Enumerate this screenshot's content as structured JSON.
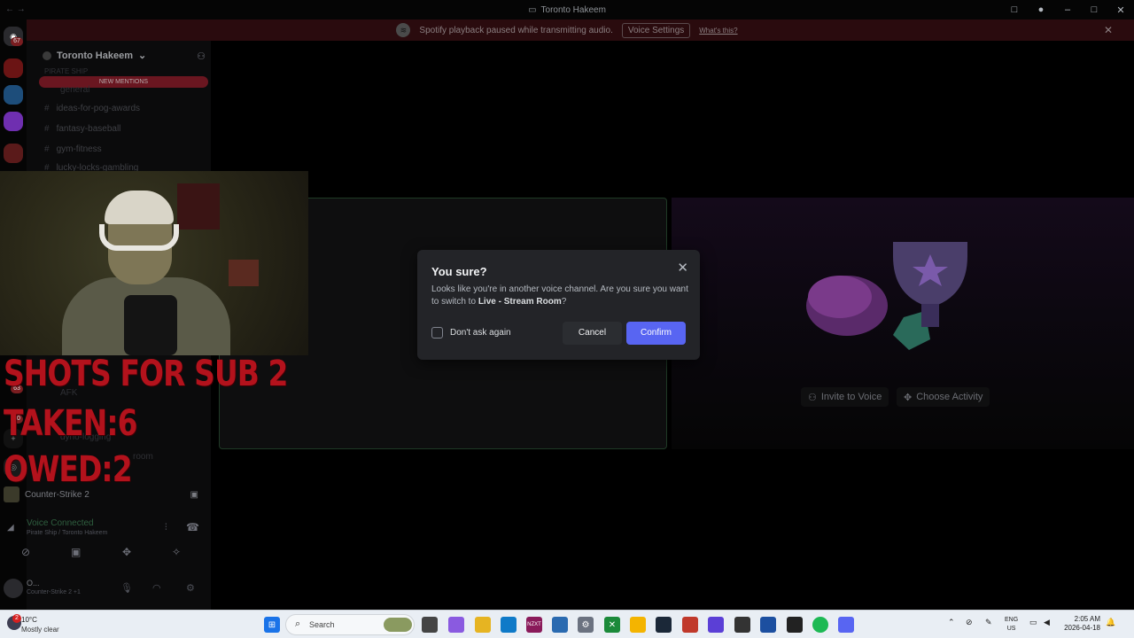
{
  "window": {
    "title": "Toronto Hakeem",
    "nav": "← →",
    "controls": [
      "□",
      "●",
      "–",
      "□",
      "✕"
    ]
  },
  "notice": {
    "text": "Spotify playback paused while transmitting audio.",
    "button": "Voice Settings",
    "link": "What's this?",
    "close": "✕"
  },
  "rail": {
    "badges": [
      "67",
      "63",
      "70"
    ]
  },
  "sidebar": {
    "server_name": "Toronto Hakeem",
    "chevron": "⌄",
    "new_mentions": "NEW MENTIONS",
    "channels": [
      "ideas-for-pog-awards",
      "fantasy-baseball",
      "gym-fitness",
      "lucky-locks-gambling"
    ],
    "ghost": {
      "pirate_ship": "PIRATE SHIP",
      "general": "general",
      "afk": "AFK",
      "dyno": "dyno-logging",
      "room": "room"
    }
  },
  "voice": {
    "game": "Counter-Strike 2",
    "connected": "Voice Connected",
    "location": "Pirate Ship / Toronto Hakeem"
  },
  "user": {
    "name": "O...",
    "status": "Counter-Strike 2 +1"
  },
  "overlay": {
    "line1": "SHOTS FOR SUB 2",
    "line2": "TAKEN:6",
    "line3": "OWED:2"
  },
  "main": {
    "invite": "Invite to Voice",
    "activity": "Choose Activity"
  },
  "dialog": {
    "title": "You sure?",
    "body_prefix": "Looks like you're in another voice channel. Are you sure you want to switch to ",
    "channel": "Live - Stream Room",
    "body_suffix": "?",
    "checkbox_label": "Don't ask again",
    "cancel": "Cancel",
    "confirm": "Confirm",
    "confirm_color": "#5865f2"
  },
  "taskbar": {
    "weather_temp": "10°C",
    "weather_desc": "Mostly clear",
    "weather_badge": "2",
    "search_placeholder": "Search",
    "lang_top": "ENG",
    "lang_bottom": "US",
    "time": "2:05 AM",
    "date": "2026-04-18"
  }
}
